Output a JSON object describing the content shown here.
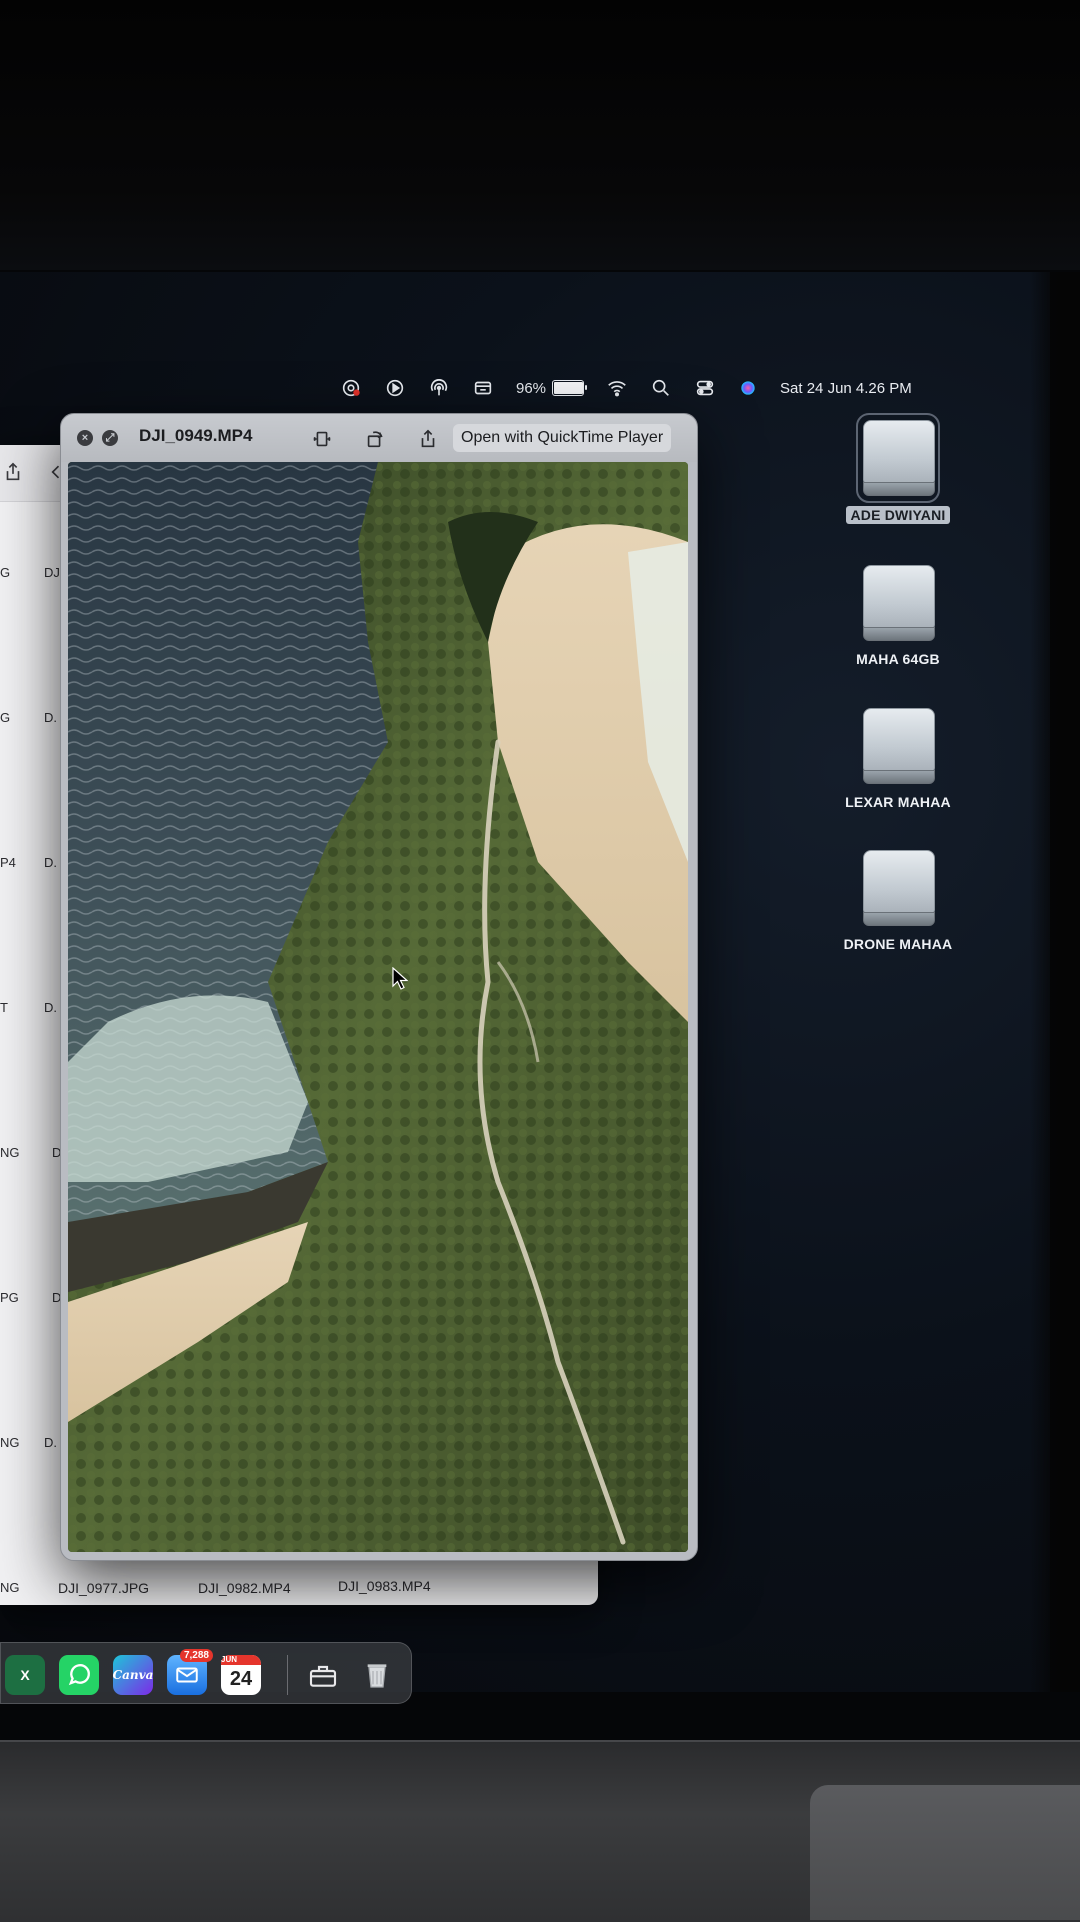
{
  "menubar": {
    "battery_percent_label": "96%",
    "battery_level": 0.96,
    "datetime": "Sat 24 Jun  4.26 PM",
    "icons": [
      "screen-record-icon",
      "play-icon",
      "airdrop-icon",
      "display-icon",
      "battery-icon",
      "wifi-icon",
      "spotlight-search-icon",
      "control-center-icon",
      "siri-icon"
    ]
  },
  "quicklook": {
    "title": "DJI_0949.MP4",
    "open_button": "Open with QuickTime Player",
    "tools": [
      "trim-icon",
      "rotate-icon",
      "share-icon"
    ]
  },
  "finder": {
    "bottom_files": [
      "DJI_0977.JPG",
      "DJI_0982.MP4",
      "DJI_0983.MP4"
    ],
    "bottom_left_fragment": "NG",
    "left_fragments": [
      "G",
      "G",
      "P4",
      "T",
      "NG",
      "PG",
      "NG"
    ],
    "col2_fragments": [
      "DJ.",
      "D.",
      "D.",
      "D.",
      "D.",
      "D.",
      "D."
    ]
  },
  "desktop": {
    "drives": [
      {
        "label": "ADE DWIYANI",
        "selected": true
      },
      {
        "label": "MAHA 64GB",
        "selected": false
      },
      {
        "label": "LEXAR MAHAA",
        "selected": false
      },
      {
        "label": "DRONE MAHAA",
        "selected": false
      }
    ]
  },
  "dock": {
    "items": [
      {
        "name": "excel",
        "glyph": "X",
        "color": "#1d6f42"
      },
      {
        "name": "whatsapp",
        "glyph": "",
        "color": "#25d366"
      },
      {
        "name": "canva",
        "glyph": "Canva",
        "color": "#7d2ae8"
      },
      {
        "name": "mail",
        "glyph": "",
        "color": "#2e8cf0",
        "badge": "7,288"
      },
      {
        "name": "calendar",
        "glyph": "24",
        "color": "#ffffff",
        "month": "JUN"
      }
    ]
  }
}
